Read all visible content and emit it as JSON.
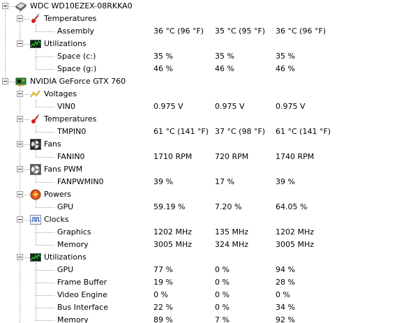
{
  "nodes": [
    {
      "level": 0,
      "kind": "device",
      "icon": "hard-drive-icon",
      "label": "WDC WD10EZEX-08RKKA0",
      "values": []
    },
    {
      "level": 1,
      "kind": "group",
      "icon": "thermometer-icon",
      "label": "Temperatures",
      "values": []
    },
    {
      "level": 2,
      "kind": "sensor",
      "label": "Assembly",
      "values": [
        "36 °C  (96 °F)",
        "35 °C  (95 °F)",
        "36 °C  (96 °F)"
      ]
    },
    {
      "level": 1,
      "kind": "group",
      "icon": "utilization-graph-icon",
      "label": "Utilizations",
      "values": []
    },
    {
      "level": 2,
      "kind": "sensor",
      "label": "Space (c:)",
      "values": [
        "35 %",
        "35 %",
        "35 %"
      ]
    },
    {
      "level": 2,
      "kind": "sensor",
      "label": "Space (g:)",
      "values": [
        "46 %",
        "46 %",
        "46 %"
      ]
    },
    {
      "level": 0,
      "kind": "device",
      "icon": "graphics-card-icon",
      "label": "NVIDIA GeForce GTX 760",
      "values": []
    },
    {
      "level": 1,
      "kind": "group",
      "icon": "voltage-icon",
      "label": "Voltages",
      "values": []
    },
    {
      "level": 2,
      "kind": "sensor",
      "label": "VIN0",
      "values": [
        "0.975 V",
        "0.975 V",
        "0.975 V"
      ]
    },
    {
      "level": 1,
      "kind": "group",
      "icon": "thermometer-icon",
      "label": "Temperatures",
      "values": []
    },
    {
      "level": 2,
      "kind": "sensor",
      "label": "TMPIN0",
      "values": [
        "61 °C  (141 °F)",
        "37 °C  (98 °F)",
        "61 °C  (141 °F)"
      ]
    },
    {
      "level": 1,
      "kind": "group",
      "icon": "fan-icon",
      "label": "Fans",
      "values": []
    },
    {
      "level": 2,
      "kind": "sensor",
      "label": "FANIN0",
      "values": [
        "1710 RPM",
        "720 RPM",
        "1740 RPM"
      ]
    },
    {
      "level": 1,
      "kind": "group",
      "icon": "fan-pwm-icon",
      "label": "Fans PWM",
      "values": []
    },
    {
      "level": 2,
      "kind": "sensor",
      "label": "FANPWMIN0",
      "values": [
        "39 %",
        "17 %",
        "39 %"
      ]
    },
    {
      "level": 1,
      "kind": "group",
      "icon": "power-icon",
      "label": "Powers",
      "values": []
    },
    {
      "level": 2,
      "kind": "sensor",
      "label": "GPU",
      "values": [
        "59.19 %",
        "7.20 %",
        "64.05 %"
      ]
    },
    {
      "level": 1,
      "kind": "group",
      "icon": "clock-icon",
      "label": "Clocks",
      "values": []
    },
    {
      "level": 2,
      "kind": "sensor",
      "label": "Graphics",
      "values": [
        "1202 MHz",
        "135 MHz",
        "1202 MHz"
      ]
    },
    {
      "level": 2,
      "kind": "sensor",
      "label": "Memory",
      "values": [
        "3005 MHz",
        "324 MHz",
        "3005 MHz"
      ]
    },
    {
      "level": 1,
      "kind": "group",
      "icon": "utilization-graph-icon",
      "label": "Utilizations",
      "values": []
    },
    {
      "level": 2,
      "kind": "sensor",
      "label": "GPU",
      "values": [
        "77 %",
        "0 %",
        "94 %"
      ]
    },
    {
      "level": 2,
      "kind": "sensor",
      "label": "Frame Buffer",
      "values": [
        "19 %",
        "0 %",
        "28 %"
      ]
    },
    {
      "level": 2,
      "kind": "sensor",
      "label": "Video Engine",
      "values": [
        "0 %",
        "0 %",
        "0 %"
      ]
    },
    {
      "level": 2,
      "kind": "sensor",
      "label": "Bus Interface",
      "values": [
        "22 %",
        "0 %",
        "34 %"
      ]
    },
    {
      "level": 2,
      "kind": "sensor",
      "label": "Memory",
      "values": [
        "89 %",
        "7 %",
        "92 %"
      ]
    }
  ]
}
